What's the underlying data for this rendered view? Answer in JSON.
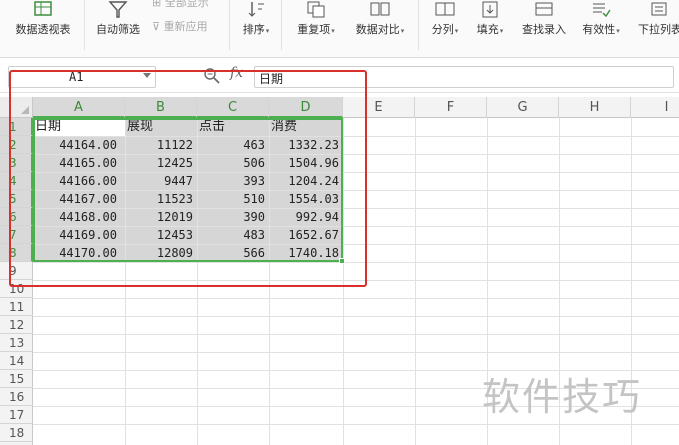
{
  "ribbon": {
    "pivot": "数据透视表",
    "autofilter": "自动筛选",
    "show_all": "全部显示",
    "reapply": "重新应用",
    "sort": "排序",
    "duplicates": "重复项",
    "compare": "数据对比",
    "split": "分列",
    "fill": "填充",
    "lookup": "查找录入",
    "validity": "有效性",
    "dropdown": "下拉列表"
  },
  "formula_bar": {
    "name_box": "A1",
    "fx": "fx",
    "content": "日期"
  },
  "columns": [
    "A",
    "B",
    "C",
    "D",
    "E",
    "F",
    "G",
    "H",
    "I"
  ],
  "rows": [
    "1",
    "2",
    "3",
    "4",
    "5",
    "6",
    "7",
    "8",
    "9",
    "10",
    "11",
    "12",
    "13",
    "14",
    "15",
    "16",
    "17",
    "18"
  ],
  "table": {
    "headers": [
      "日期",
      "展现",
      "点击",
      "消费"
    ],
    "rows": [
      [
        "44164.00",
        "11122",
        "463",
        "1332.23"
      ],
      [
        "44165.00",
        "12425",
        "506",
        "1504.96"
      ],
      [
        "44166.00",
        "9447",
        "393",
        "1204.24"
      ],
      [
        "44167.00",
        "11523",
        "510",
        "1554.03"
      ],
      [
        "44168.00",
        "12019",
        "390",
        "992.94"
      ],
      [
        "44169.00",
        "12453",
        "483",
        "1652.67"
      ],
      [
        "44170.00",
        "12809",
        "566",
        "1740.18"
      ]
    ]
  },
  "watermark": "软件技巧",
  "colors": {
    "selection": "#4caf50",
    "highlight_box": "#d9302c"
  }
}
